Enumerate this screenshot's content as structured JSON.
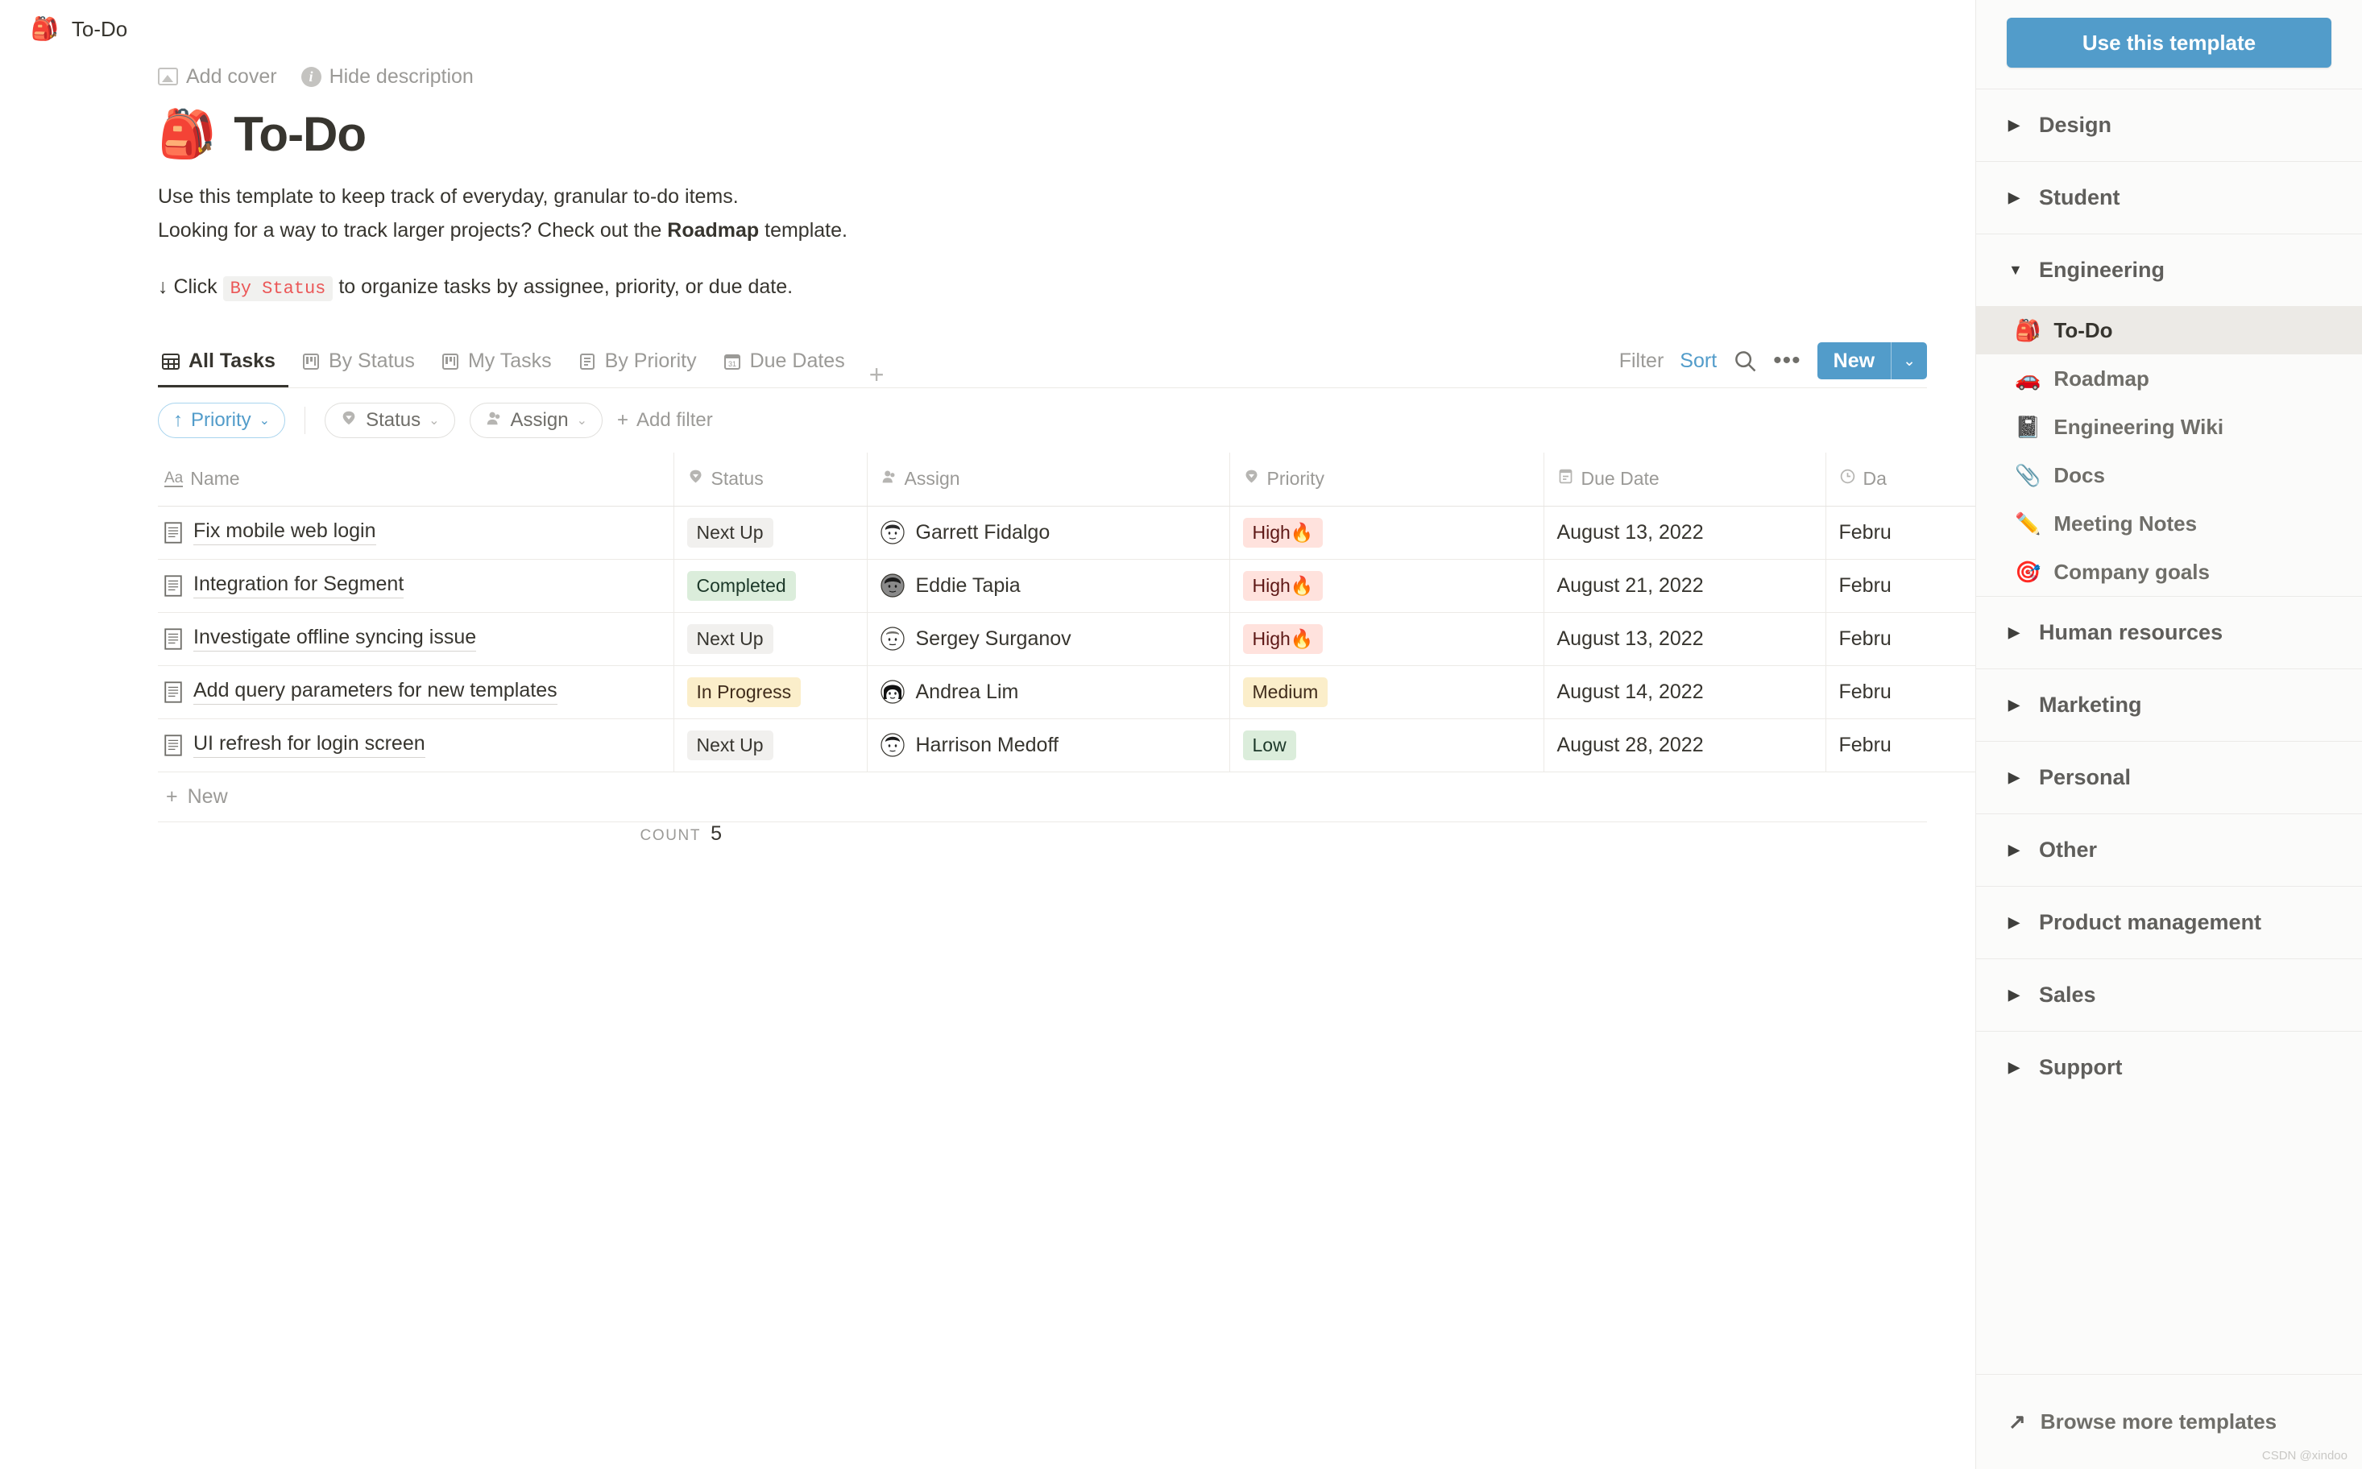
{
  "topbar": {
    "emoji": "🎒",
    "title": "To-Do"
  },
  "page_controls": {
    "add_cover": "Add cover",
    "hide_description": "Hide description"
  },
  "page": {
    "emoji": "🎒",
    "title": "To-Do",
    "desc_line1": "Use this template to keep track of everyday, granular to-do items.",
    "desc_line2_pre": "Looking for a way to track larger projects? Check out the ",
    "desc_line2_bold": "Roadmap",
    "desc_line2_post": " template.",
    "hint_pre": "↓ Click ",
    "hint_code": "By Status",
    "hint_post": " to organize tasks by assignee, priority, or due date."
  },
  "tabs": [
    {
      "label": "All Tasks",
      "icon": "table-icon",
      "active": true
    },
    {
      "label": "By Status",
      "icon": "board-icon",
      "active": false
    },
    {
      "label": "My Tasks",
      "icon": "board-icon",
      "active": false
    },
    {
      "label": "By Priority",
      "icon": "list-icon",
      "active": false
    },
    {
      "label": "Due Dates",
      "icon": "calendar-icon",
      "active": false
    }
  ],
  "tabs_add": "+",
  "toolbar": {
    "filter_label": "Filter",
    "sort_label": "Sort",
    "search_icon": "search-icon",
    "more_icon": "ellipsis-icon",
    "new_label": "New",
    "new_caret": "⌄",
    "accent_blue": "#529cca"
  },
  "filters": {
    "chips": [
      {
        "label": "Priority",
        "icon": "sort-arrow-up-icon",
        "active": true
      },
      {
        "label": "Status",
        "icon": "select-icon",
        "active": false
      },
      {
        "label": "Assign",
        "icon": "person-icon",
        "active": false
      }
    ],
    "add_filter": "Add filter"
  },
  "table": {
    "columns": [
      {
        "label": "Name",
        "icon": "text-aa-icon"
      },
      {
        "label": "Status",
        "icon": "select-icon"
      },
      {
        "label": "Assign",
        "icon": "person-icon"
      },
      {
        "label": "Priority",
        "icon": "select-icon"
      },
      {
        "label": "Due Date",
        "icon": "date-icon"
      },
      {
        "label": "Da",
        "icon": "clock-icon"
      }
    ],
    "rows": [
      {
        "name": "Fix mobile web login",
        "status": "Next Up",
        "status_color": "gray",
        "assign": "Garrett Fidalgo",
        "priority": "High🔥",
        "priority_color": "red",
        "due_date": "August 13, 2022",
        "date_created": "Febru"
      },
      {
        "name": "Integration for Segment",
        "status": "Completed",
        "status_color": "green",
        "assign": "Eddie Tapia",
        "priority": "High🔥",
        "priority_color": "red",
        "due_date": "August 21, 2022",
        "date_created": "Febru"
      },
      {
        "name": "Investigate offline syncing issue",
        "status": "Next Up",
        "status_color": "gray",
        "assign": "Sergey Surganov",
        "priority": "High🔥",
        "priority_color": "red",
        "due_date": "August 13, 2022",
        "date_created": "Febru"
      },
      {
        "name": "Add query parameters for new templates",
        "status": "In Progress",
        "status_color": "yellow",
        "assign": "Andrea Lim",
        "priority": "Medium",
        "priority_color": "yellow",
        "due_date": "August 14, 2022",
        "date_created": "Febru"
      },
      {
        "name": "UI refresh for login screen",
        "status": "Next Up",
        "status_color": "gray",
        "assign": "Harrison Medoff",
        "priority": "Low",
        "priority_color": "green",
        "due_date": "August 28, 2022",
        "date_created": "Febru"
      }
    ],
    "new_row_label": "New",
    "count_label": "COUNT",
    "count_value": "5"
  },
  "sidebar": {
    "use_template_label": "Use this template",
    "categories": [
      {
        "label": "Design",
        "expanded": false,
        "items": []
      },
      {
        "label": "Student",
        "expanded": false,
        "items": []
      },
      {
        "label": "Engineering",
        "expanded": true,
        "items": [
          {
            "emoji": "🎒",
            "label": "To-Do",
            "active": true
          },
          {
            "emoji": "🚗",
            "label": "Roadmap",
            "active": false
          },
          {
            "emoji": "📓",
            "label": "Engineering Wiki",
            "active": false
          },
          {
            "emoji": "📎",
            "label": "Docs",
            "active": false
          },
          {
            "emoji": "✏️",
            "label": "Meeting Notes",
            "active": false
          },
          {
            "emoji": "🎯",
            "label": "Company goals",
            "active": false
          }
        ]
      },
      {
        "label": "Human resources",
        "expanded": false,
        "items": []
      },
      {
        "label": "Marketing",
        "expanded": false,
        "items": []
      },
      {
        "label": "Personal",
        "expanded": false,
        "items": []
      },
      {
        "label": "Other",
        "expanded": false,
        "items": []
      },
      {
        "label": "Product management",
        "expanded": false,
        "items": []
      },
      {
        "label": "Sales",
        "expanded": false,
        "items": []
      },
      {
        "label": "Support",
        "expanded": false,
        "items": []
      }
    ],
    "browse_more": "Browse more templates",
    "browse_icon": "arrow-up-right-icon"
  },
  "watermark": "CSDN @xindoo"
}
